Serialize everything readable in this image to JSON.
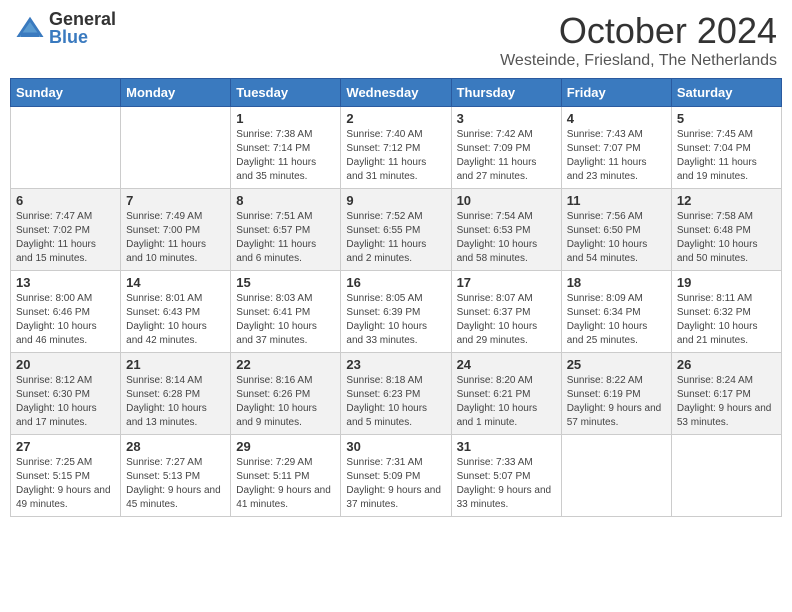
{
  "logo": {
    "general": "General",
    "blue": "Blue"
  },
  "header": {
    "month": "October 2024",
    "location": "Westeinde, Friesland, The Netherlands"
  },
  "days_of_week": [
    "Sunday",
    "Monday",
    "Tuesday",
    "Wednesday",
    "Thursday",
    "Friday",
    "Saturday"
  ],
  "weeks": [
    [
      {
        "day": "",
        "empty": true
      },
      {
        "day": "",
        "empty": true
      },
      {
        "day": "1",
        "sunrise": "7:38 AM",
        "sunset": "7:14 PM",
        "daylight": "11 hours and 35 minutes."
      },
      {
        "day": "2",
        "sunrise": "7:40 AM",
        "sunset": "7:12 PM",
        "daylight": "11 hours and 31 minutes."
      },
      {
        "day": "3",
        "sunrise": "7:42 AM",
        "sunset": "7:09 PM",
        "daylight": "11 hours and 27 minutes."
      },
      {
        "day": "4",
        "sunrise": "7:43 AM",
        "sunset": "7:07 PM",
        "daylight": "11 hours and 23 minutes."
      },
      {
        "day": "5",
        "sunrise": "7:45 AM",
        "sunset": "7:04 PM",
        "daylight": "11 hours and 19 minutes."
      }
    ],
    [
      {
        "day": "6",
        "sunrise": "7:47 AM",
        "sunset": "7:02 PM",
        "daylight": "11 hours and 15 minutes."
      },
      {
        "day": "7",
        "sunrise": "7:49 AM",
        "sunset": "7:00 PM",
        "daylight": "11 hours and 10 minutes."
      },
      {
        "day": "8",
        "sunrise": "7:51 AM",
        "sunset": "6:57 PM",
        "daylight": "11 hours and 6 minutes."
      },
      {
        "day": "9",
        "sunrise": "7:52 AM",
        "sunset": "6:55 PM",
        "daylight": "11 hours and 2 minutes."
      },
      {
        "day": "10",
        "sunrise": "7:54 AM",
        "sunset": "6:53 PM",
        "daylight": "10 hours and 58 minutes."
      },
      {
        "day": "11",
        "sunrise": "7:56 AM",
        "sunset": "6:50 PM",
        "daylight": "10 hours and 54 minutes."
      },
      {
        "day": "12",
        "sunrise": "7:58 AM",
        "sunset": "6:48 PM",
        "daylight": "10 hours and 50 minutes."
      }
    ],
    [
      {
        "day": "13",
        "sunrise": "8:00 AM",
        "sunset": "6:46 PM",
        "daylight": "10 hours and 46 minutes."
      },
      {
        "day": "14",
        "sunrise": "8:01 AM",
        "sunset": "6:43 PM",
        "daylight": "10 hours and 42 minutes."
      },
      {
        "day": "15",
        "sunrise": "8:03 AM",
        "sunset": "6:41 PM",
        "daylight": "10 hours and 37 minutes."
      },
      {
        "day": "16",
        "sunrise": "8:05 AM",
        "sunset": "6:39 PM",
        "daylight": "10 hours and 33 minutes."
      },
      {
        "day": "17",
        "sunrise": "8:07 AM",
        "sunset": "6:37 PM",
        "daylight": "10 hours and 29 minutes."
      },
      {
        "day": "18",
        "sunrise": "8:09 AM",
        "sunset": "6:34 PM",
        "daylight": "10 hours and 25 minutes."
      },
      {
        "day": "19",
        "sunrise": "8:11 AM",
        "sunset": "6:32 PM",
        "daylight": "10 hours and 21 minutes."
      }
    ],
    [
      {
        "day": "20",
        "sunrise": "8:12 AM",
        "sunset": "6:30 PM",
        "daylight": "10 hours and 17 minutes."
      },
      {
        "day": "21",
        "sunrise": "8:14 AM",
        "sunset": "6:28 PM",
        "daylight": "10 hours and 13 minutes."
      },
      {
        "day": "22",
        "sunrise": "8:16 AM",
        "sunset": "6:26 PM",
        "daylight": "10 hours and 9 minutes."
      },
      {
        "day": "23",
        "sunrise": "8:18 AM",
        "sunset": "6:23 PM",
        "daylight": "10 hours and 5 minutes."
      },
      {
        "day": "24",
        "sunrise": "8:20 AM",
        "sunset": "6:21 PM",
        "daylight": "10 hours and 1 minute."
      },
      {
        "day": "25",
        "sunrise": "8:22 AM",
        "sunset": "6:19 PM",
        "daylight": "9 hours and 57 minutes."
      },
      {
        "day": "26",
        "sunrise": "8:24 AM",
        "sunset": "6:17 PM",
        "daylight": "9 hours and 53 minutes."
      }
    ],
    [
      {
        "day": "27",
        "sunrise": "7:25 AM",
        "sunset": "5:15 PM",
        "daylight": "9 hours and 49 minutes."
      },
      {
        "day": "28",
        "sunrise": "7:27 AM",
        "sunset": "5:13 PM",
        "daylight": "9 hours and 45 minutes."
      },
      {
        "day": "29",
        "sunrise": "7:29 AM",
        "sunset": "5:11 PM",
        "daylight": "9 hours and 41 minutes."
      },
      {
        "day": "30",
        "sunrise": "7:31 AM",
        "sunset": "5:09 PM",
        "daylight": "9 hours and 37 minutes."
      },
      {
        "day": "31",
        "sunrise": "7:33 AM",
        "sunset": "5:07 PM",
        "daylight": "9 hours and 33 minutes."
      },
      {
        "day": "",
        "empty": true
      },
      {
        "day": "",
        "empty": true
      }
    ]
  ],
  "labels": {
    "sunrise": "Sunrise:",
    "sunset": "Sunset:",
    "daylight": "Daylight:"
  }
}
